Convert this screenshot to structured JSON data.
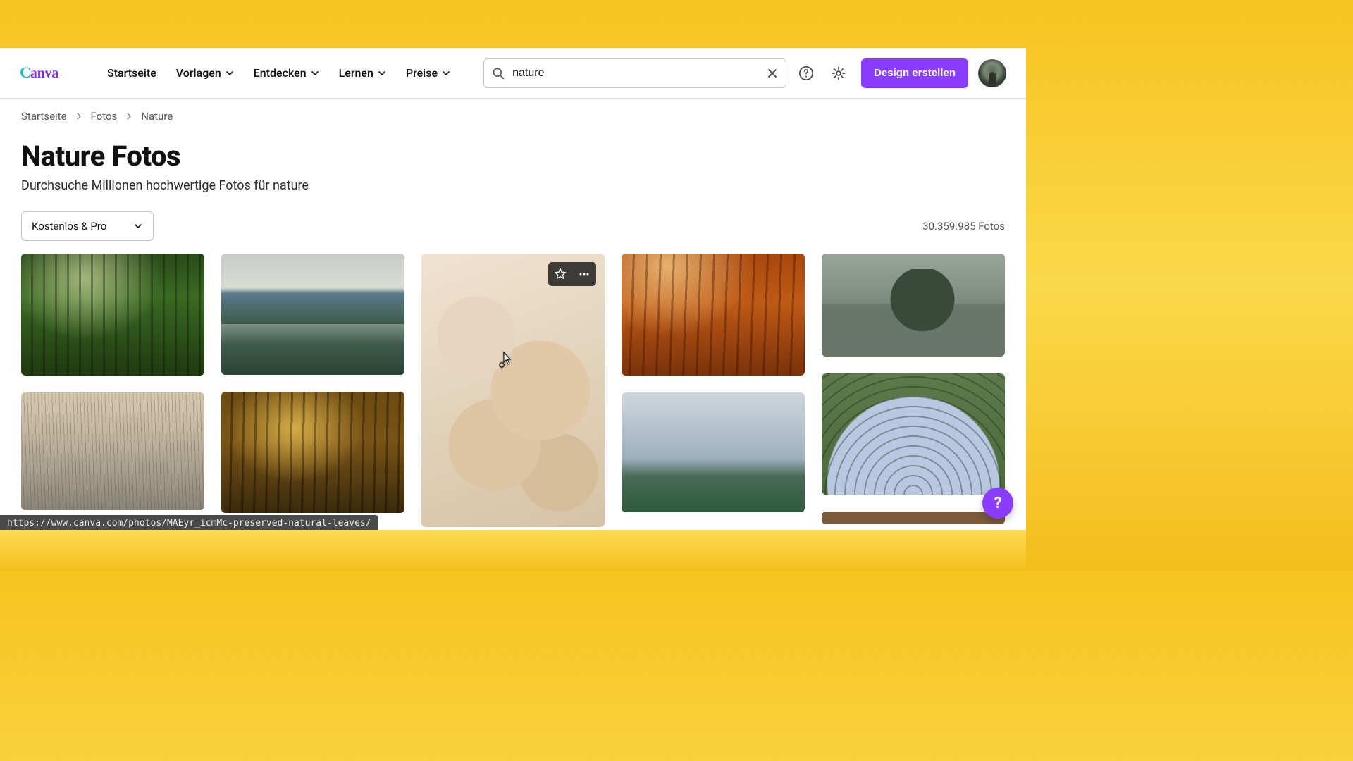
{
  "nav": {
    "home": "Startseite",
    "templates": "Vorlagen",
    "discover": "Entdecken",
    "learn": "Lernen",
    "pricing": "Preise"
  },
  "search": {
    "value": "nature"
  },
  "cta": "Design erstellen",
  "breadcrumb": {
    "home": "Startseite",
    "photos": "Fotos",
    "current": "Nature"
  },
  "page": {
    "title": "Nature Fotos",
    "subtitle": "Durchsuche Millionen hochwertige Fotos für nature"
  },
  "filter_label": "Kostenlos & Pro",
  "result_count": "30.359.985 Fotos",
  "status_url": "https://www.canva.com/photos/MAEyr_icmMc-preserved-natural-leaves/",
  "fab_label": "?"
}
